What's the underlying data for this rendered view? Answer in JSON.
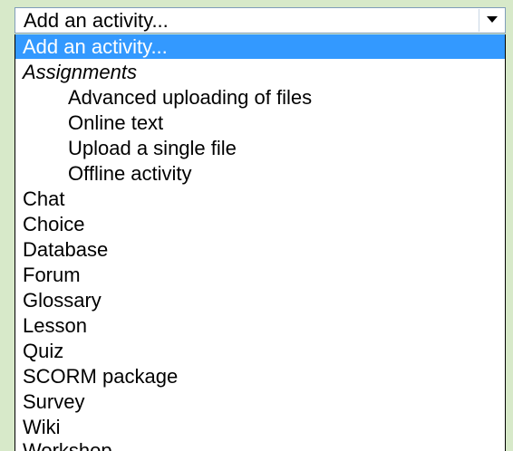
{
  "select": {
    "current_value": "Add an activity..."
  },
  "dropdown": {
    "options": [
      {
        "label": "Add an activity...",
        "type": "option",
        "selected": true
      },
      {
        "label": "Assignments",
        "type": "group"
      },
      {
        "label": "Advanced uploading of files",
        "type": "suboption"
      },
      {
        "label": "Online text",
        "type": "suboption"
      },
      {
        "label": "Upload a single file",
        "type": "suboption"
      },
      {
        "label": "Offline activity",
        "type": "suboption"
      },
      {
        "label": "Chat",
        "type": "option"
      },
      {
        "label": "Choice",
        "type": "option"
      },
      {
        "label": "Database",
        "type": "option"
      },
      {
        "label": "Forum",
        "type": "option"
      },
      {
        "label": "Glossary",
        "type": "option"
      },
      {
        "label": "Lesson",
        "type": "option"
      },
      {
        "label": "Quiz",
        "type": "option"
      },
      {
        "label": "SCORM package",
        "type": "option"
      },
      {
        "label": "Survey",
        "type": "option"
      },
      {
        "label": "Wiki",
        "type": "option"
      },
      {
        "label": "Workshop",
        "type": "option"
      }
    ]
  },
  "colors": {
    "page_bg": "#d7e9c9",
    "selection_bg": "#3399ff",
    "selection_text": "#ffffff",
    "border": "#7f9db9"
  }
}
